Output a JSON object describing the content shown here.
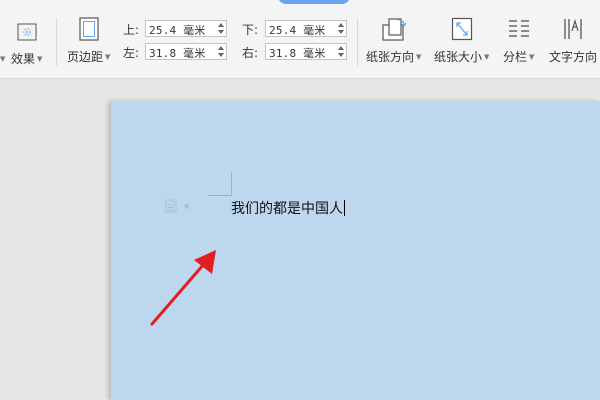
{
  "toolbar": {
    "effects_label": "效果",
    "margins_label": "页边距",
    "orientation_label": "纸张方向",
    "size_label": "纸张大小",
    "columns_label": "分栏",
    "text_direction_label": "文字方向",
    "margins": {
      "top": {
        "label": "上:",
        "value": "25.4 毫米"
      },
      "bottom": {
        "label": "下:",
        "value": "25.4 毫米"
      },
      "left": {
        "label": "左:",
        "value": "31.8 毫米"
      },
      "right": {
        "label": "右:",
        "value": "31.8 毫米"
      }
    },
    "icons": {
      "effects": "effects-icon",
      "margins": "page-margins-icon",
      "orientation": "page-orientation-icon",
      "size": "paper-size-icon",
      "columns": "columns-icon",
      "text_direction": "text-direction-icon"
    }
  },
  "document": {
    "text": "我们的都是中国人",
    "page_color": "#bdd7ee"
  },
  "annotation": {
    "arrow_color": "#e02020"
  }
}
